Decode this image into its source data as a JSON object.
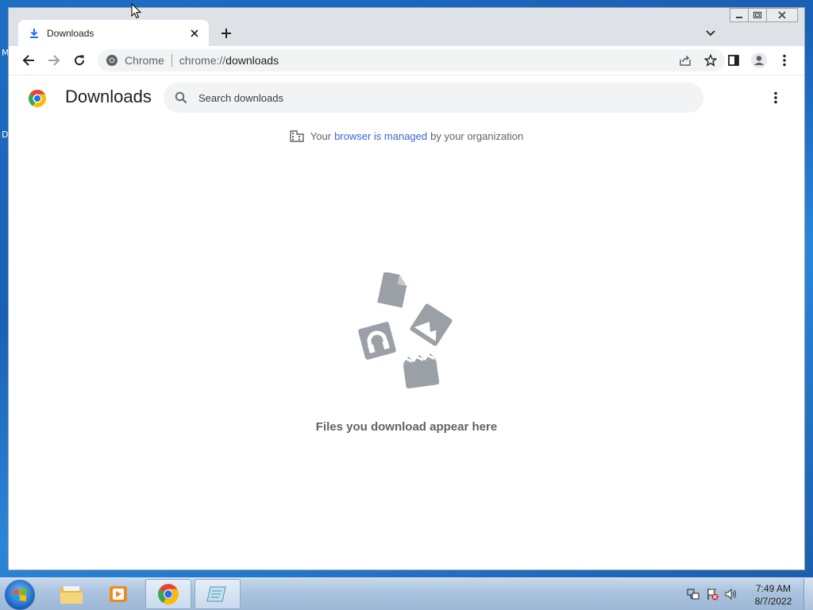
{
  "desktop": {
    "fragment_top": "M",
    "fragment_mid": "D"
  },
  "window": {
    "tab": {
      "title": "Downloads"
    },
    "caption": {
      "minimize": "—",
      "maximize": "▢",
      "close": "✕"
    }
  },
  "toolbar": {
    "omnibox_label": "Chrome",
    "url_scheme": "chrome://",
    "url_host": "downloads"
  },
  "downloads": {
    "title": "Downloads",
    "search_placeholder": "Search downloads",
    "managed_prefix": "Your",
    "managed_link": "browser is managed",
    "managed_suffix": "by your organization",
    "empty_message": "Files you download appear here"
  },
  "taskbar": {
    "time": "7:49 AM",
    "date": "8/7/2022"
  },
  "colors": {
    "chrome_blue": "#1a73e8",
    "empty_art": "#9aa0a6"
  }
}
